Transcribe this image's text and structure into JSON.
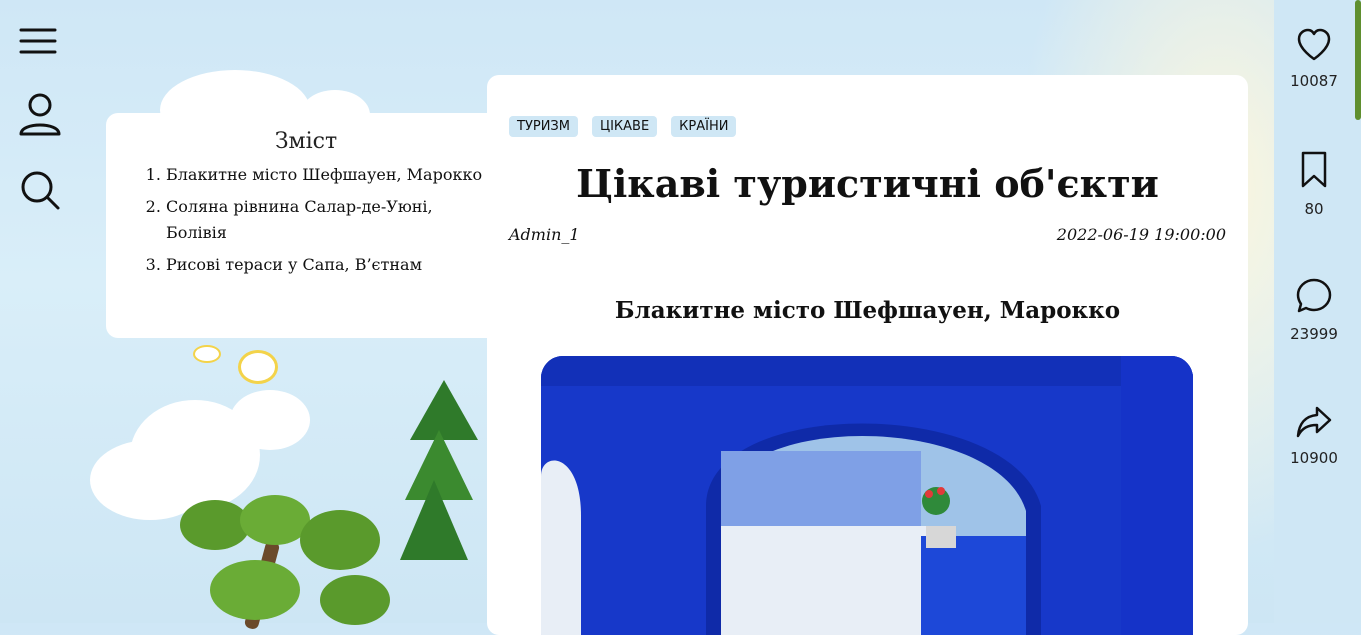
{
  "nav": {
    "icons": [
      "menu-icon",
      "user-icon",
      "search-icon"
    ]
  },
  "toc": {
    "title": "Зміст",
    "items": [
      "Блакитне місто Шефшауен, Марокко",
      "Соляна рівнина Салар-де-Уюні, Болівія",
      "Рисові тераси у Сапа, В’єтнам"
    ]
  },
  "article": {
    "tags": [
      "ТУРИЗМ",
      "ЦІКАВЕ",
      "КРАЇНИ"
    ],
    "title": "Цікаві туристичні об'єкти",
    "author": "Admin_1",
    "date": "2022-06-19 19:00:00",
    "section_heading": "Блакитне місто Шефшауен, Марокко"
  },
  "actions": {
    "likes": "10087",
    "bookmarks": "80",
    "comments": "23999",
    "shares": "10900"
  },
  "colors": {
    "tag_bg": "#cfe7f5",
    "sidebar_bg": "#cfe7f5",
    "scroll_accent": "#5f8f2f"
  }
}
